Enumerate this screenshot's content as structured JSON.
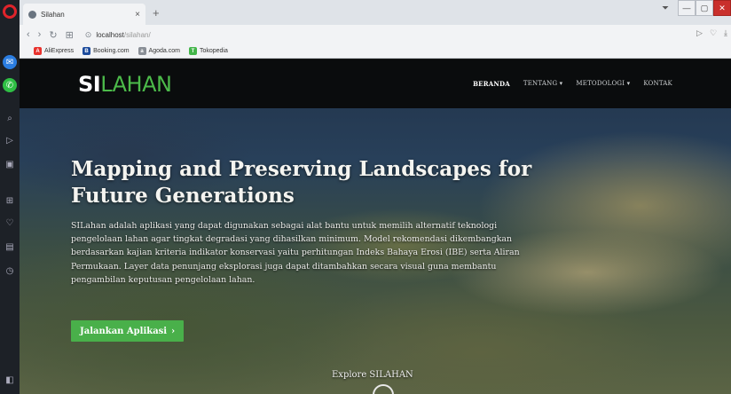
{
  "browser": {
    "tab_title": "Silahan",
    "tab_close": "×",
    "new_tab": "+",
    "url_host": "localhost",
    "url_path": "/silahan/",
    "window_controls": [
      "—",
      "▢",
      "✕"
    ],
    "bookmarks": [
      {
        "label": "AliExpress",
        "color": "#e8322d",
        "glyph": "A"
      },
      {
        "label": "Booking.com",
        "color": "#1c4b9c",
        "glyph": "B"
      },
      {
        "label": "Agoda.com",
        "color": "#8a8f96",
        "glyph": "a"
      },
      {
        "label": "Tokopedia",
        "color": "#42b549",
        "glyph": "T"
      }
    ]
  },
  "site": {
    "logo_si": "SI",
    "logo_lahan": "LAHAN",
    "menu": {
      "beranda": "BERANDA",
      "tentang": "TENTANG ▾",
      "metodologi": "METODOLOGI ▾",
      "kontak": "KONTAK"
    },
    "hero": {
      "title": "Mapping and Preserving Landscapes for Future Generations",
      "description": "SILahan adalah aplikasi yang dapat digunakan sebagai alat bantu untuk memilih alternatif teknologi pengelolaan lahan agar tingkat degradasi yang dihasilkan minimum. Model rekomendasi dikembangkan berdasarkan kajian kriteria indikator konservasi yaitu perhitungan Indeks Bahaya Erosi (IBE) serta Aliran Permukaan. Layer data penunjang eksplorasi juga dapat ditambahkan secara visual guna membantu pengambilan keputusan pengelolaan lahan.",
      "cta_label": "Jalankan Aplikasi",
      "cta_chevron": "›",
      "explore": "Explore SILAHAN"
    }
  },
  "colors": {
    "brand_green": "#4cba4a",
    "nav_bg": "#0a0c0d",
    "opera_red": "#e0242b"
  }
}
